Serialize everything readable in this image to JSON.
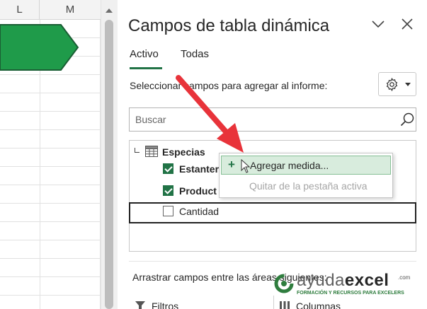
{
  "sheet": {
    "columns": [
      "L",
      "M"
    ]
  },
  "panel": {
    "title": "Campos de tabla dinámica",
    "tabs": [
      {
        "label": "Activo",
        "active": true
      },
      {
        "label": "Todas",
        "active": false
      }
    ],
    "instruction": "Seleccionar campos para agregar al informe:",
    "search": {
      "placeholder": "Buscar"
    },
    "table": {
      "name": "Especias",
      "fields": [
        {
          "label": "Estanter",
          "checked": true
        },
        {
          "label": "Product",
          "checked": true
        },
        {
          "label": "Cantidad",
          "checked": false
        }
      ]
    },
    "context_menu": {
      "items": [
        {
          "label": "Agregar medida...",
          "enabled": true,
          "icon": "plus-icon"
        },
        {
          "label": "Quitar de la pestaña activa",
          "enabled": false
        }
      ]
    },
    "drag_instruction": "Arrastrar campos entre las áreas siguientes:",
    "areas": [
      {
        "label": "Filtros",
        "icon": "filter-icon"
      },
      {
        "label": "Columnas",
        "icon": "columns-icon"
      }
    ]
  },
  "watermark": {
    "brand_light": "ayuda",
    "brand_bold": "excel",
    "domain": ".com",
    "tagline": "FORMACIÓN Y RECURSOS PARA EXCELERS"
  },
  "colors": {
    "accent": "#217346",
    "shape_fill": "#1f9b4a",
    "arrow": "#e8333a",
    "menu_highlight": "#d8ecdd"
  }
}
